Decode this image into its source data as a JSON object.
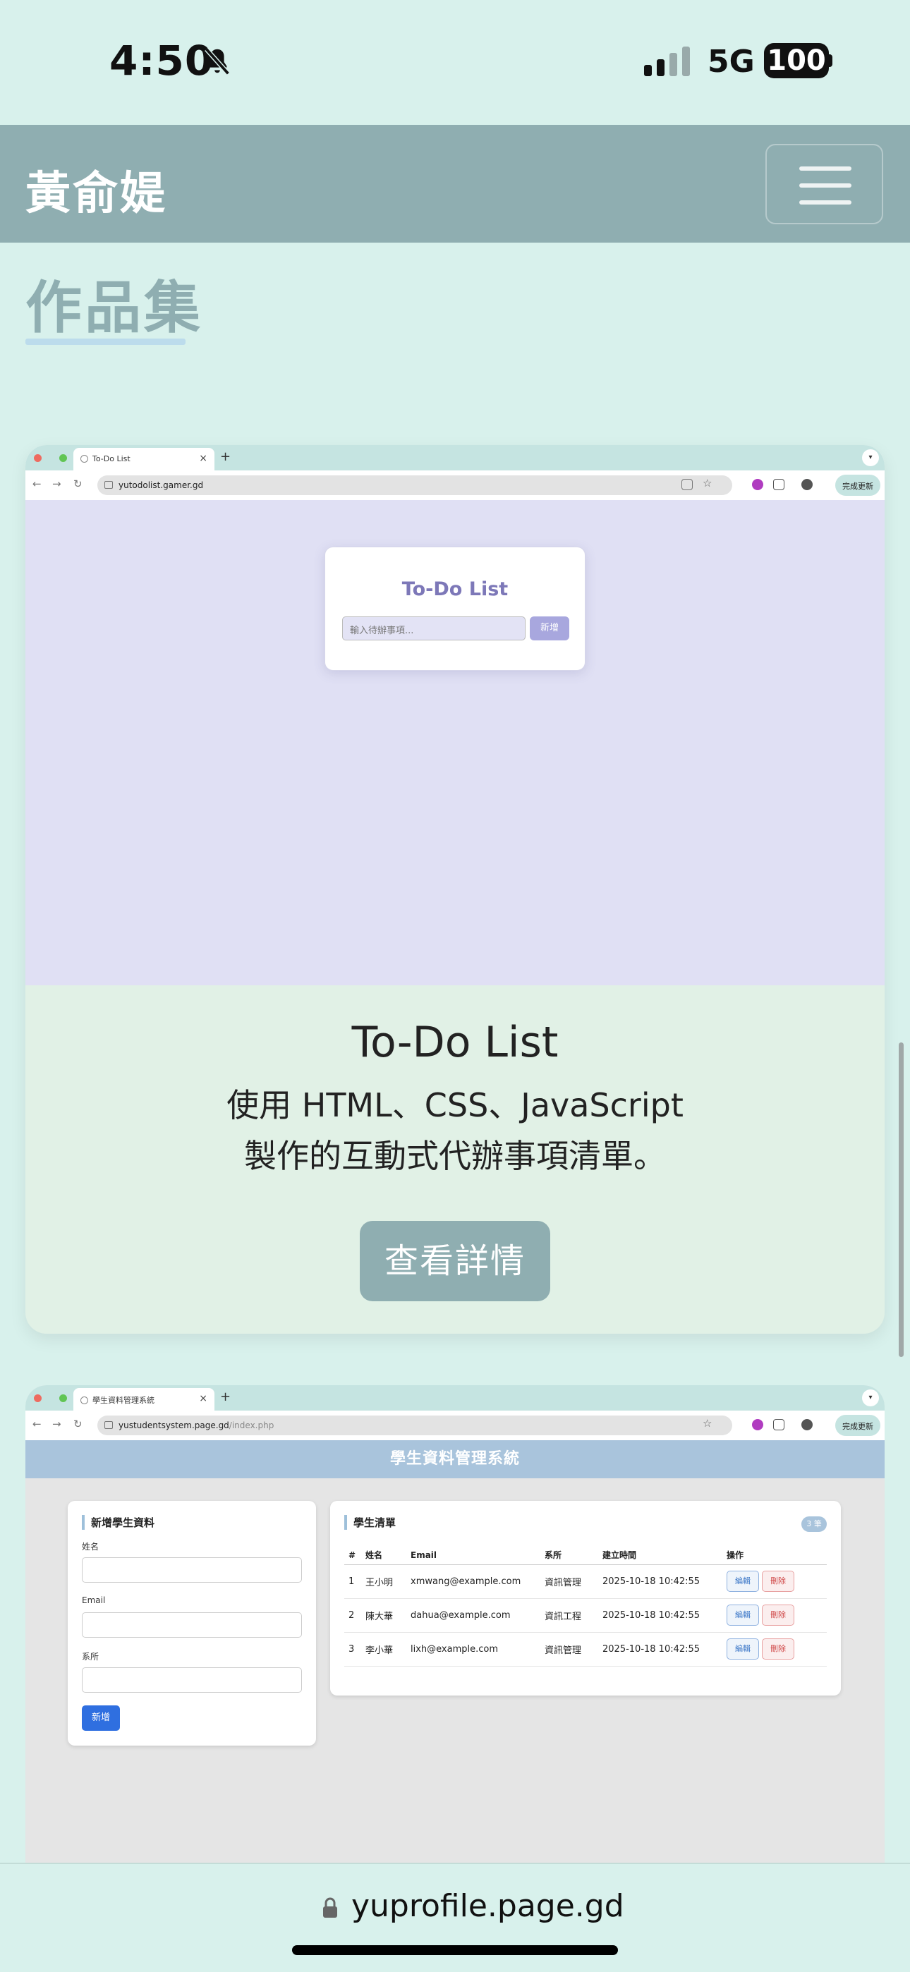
{
  "status_bar": {
    "time": "4:50",
    "network": "5G",
    "battery": "100"
  },
  "navbar": {
    "brand": "黃俞媞"
  },
  "section": {
    "title": "作品集"
  },
  "card_todo": {
    "browser": {
      "tab_title": "To-Do List",
      "url": "yutodolist.gamer.gd",
      "update_label": "完成更新"
    },
    "app": {
      "title": "To-Do List",
      "input_placeholder": "輸入待辦事項...",
      "add_label": "新增"
    },
    "title": "To-Do List",
    "description_line1": "使用 HTML、CSS、JavaScript",
    "description_line2": "製作的互動式代辦事項清單。",
    "details_label": "查看詳情"
  },
  "card_students": {
    "browser": {
      "tab_title": "學生資料管理系統",
      "url_host": "yustudentsystem.page.gd",
      "url_path": "/index.php",
      "update_label": "完成更新"
    },
    "app": {
      "header": "學生資料管理系統",
      "form": {
        "heading": "新增學生資料",
        "name_label": "姓名",
        "email_label": "Email",
        "dept_label": "系所",
        "submit_label": "新增"
      },
      "list": {
        "heading": "學生清單",
        "count_badge": "3 筆",
        "columns": [
          "#",
          "姓名",
          "Email",
          "系所",
          "建立時間",
          "操作"
        ],
        "edit_label": "編輯",
        "delete_label": "刪除",
        "rows": [
          {
            "id": "1",
            "name": "王小明",
            "email": "xmwang@example.com",
            "dept": "資訊管理",
            "created": "2025-10-18 10:42:55"
          },
          {
            "id": "2",
            "name": "陳大華",
            "email": "dahua@example.com",
            "dept": "資訊工程",
            "created": "2025-10-18 10:42:55"
          },
          {
            "id": "3",
            "name": "李小華",
            "email": "lixh@example.com",
            "dept": "資訊管理",
            "created": "2025-10-18 10:42:55"
          }
        ]
      }
    }
  },
  "safari": {
    "url": "yuprofile.page.gd"
  },
  "colors": {
    "background": "#d8f1ec",
    "navbar": "#8faeb1",
    "card": "#e1f1e6",
    "accent_blue": "#2f6fe0"
  }
}
